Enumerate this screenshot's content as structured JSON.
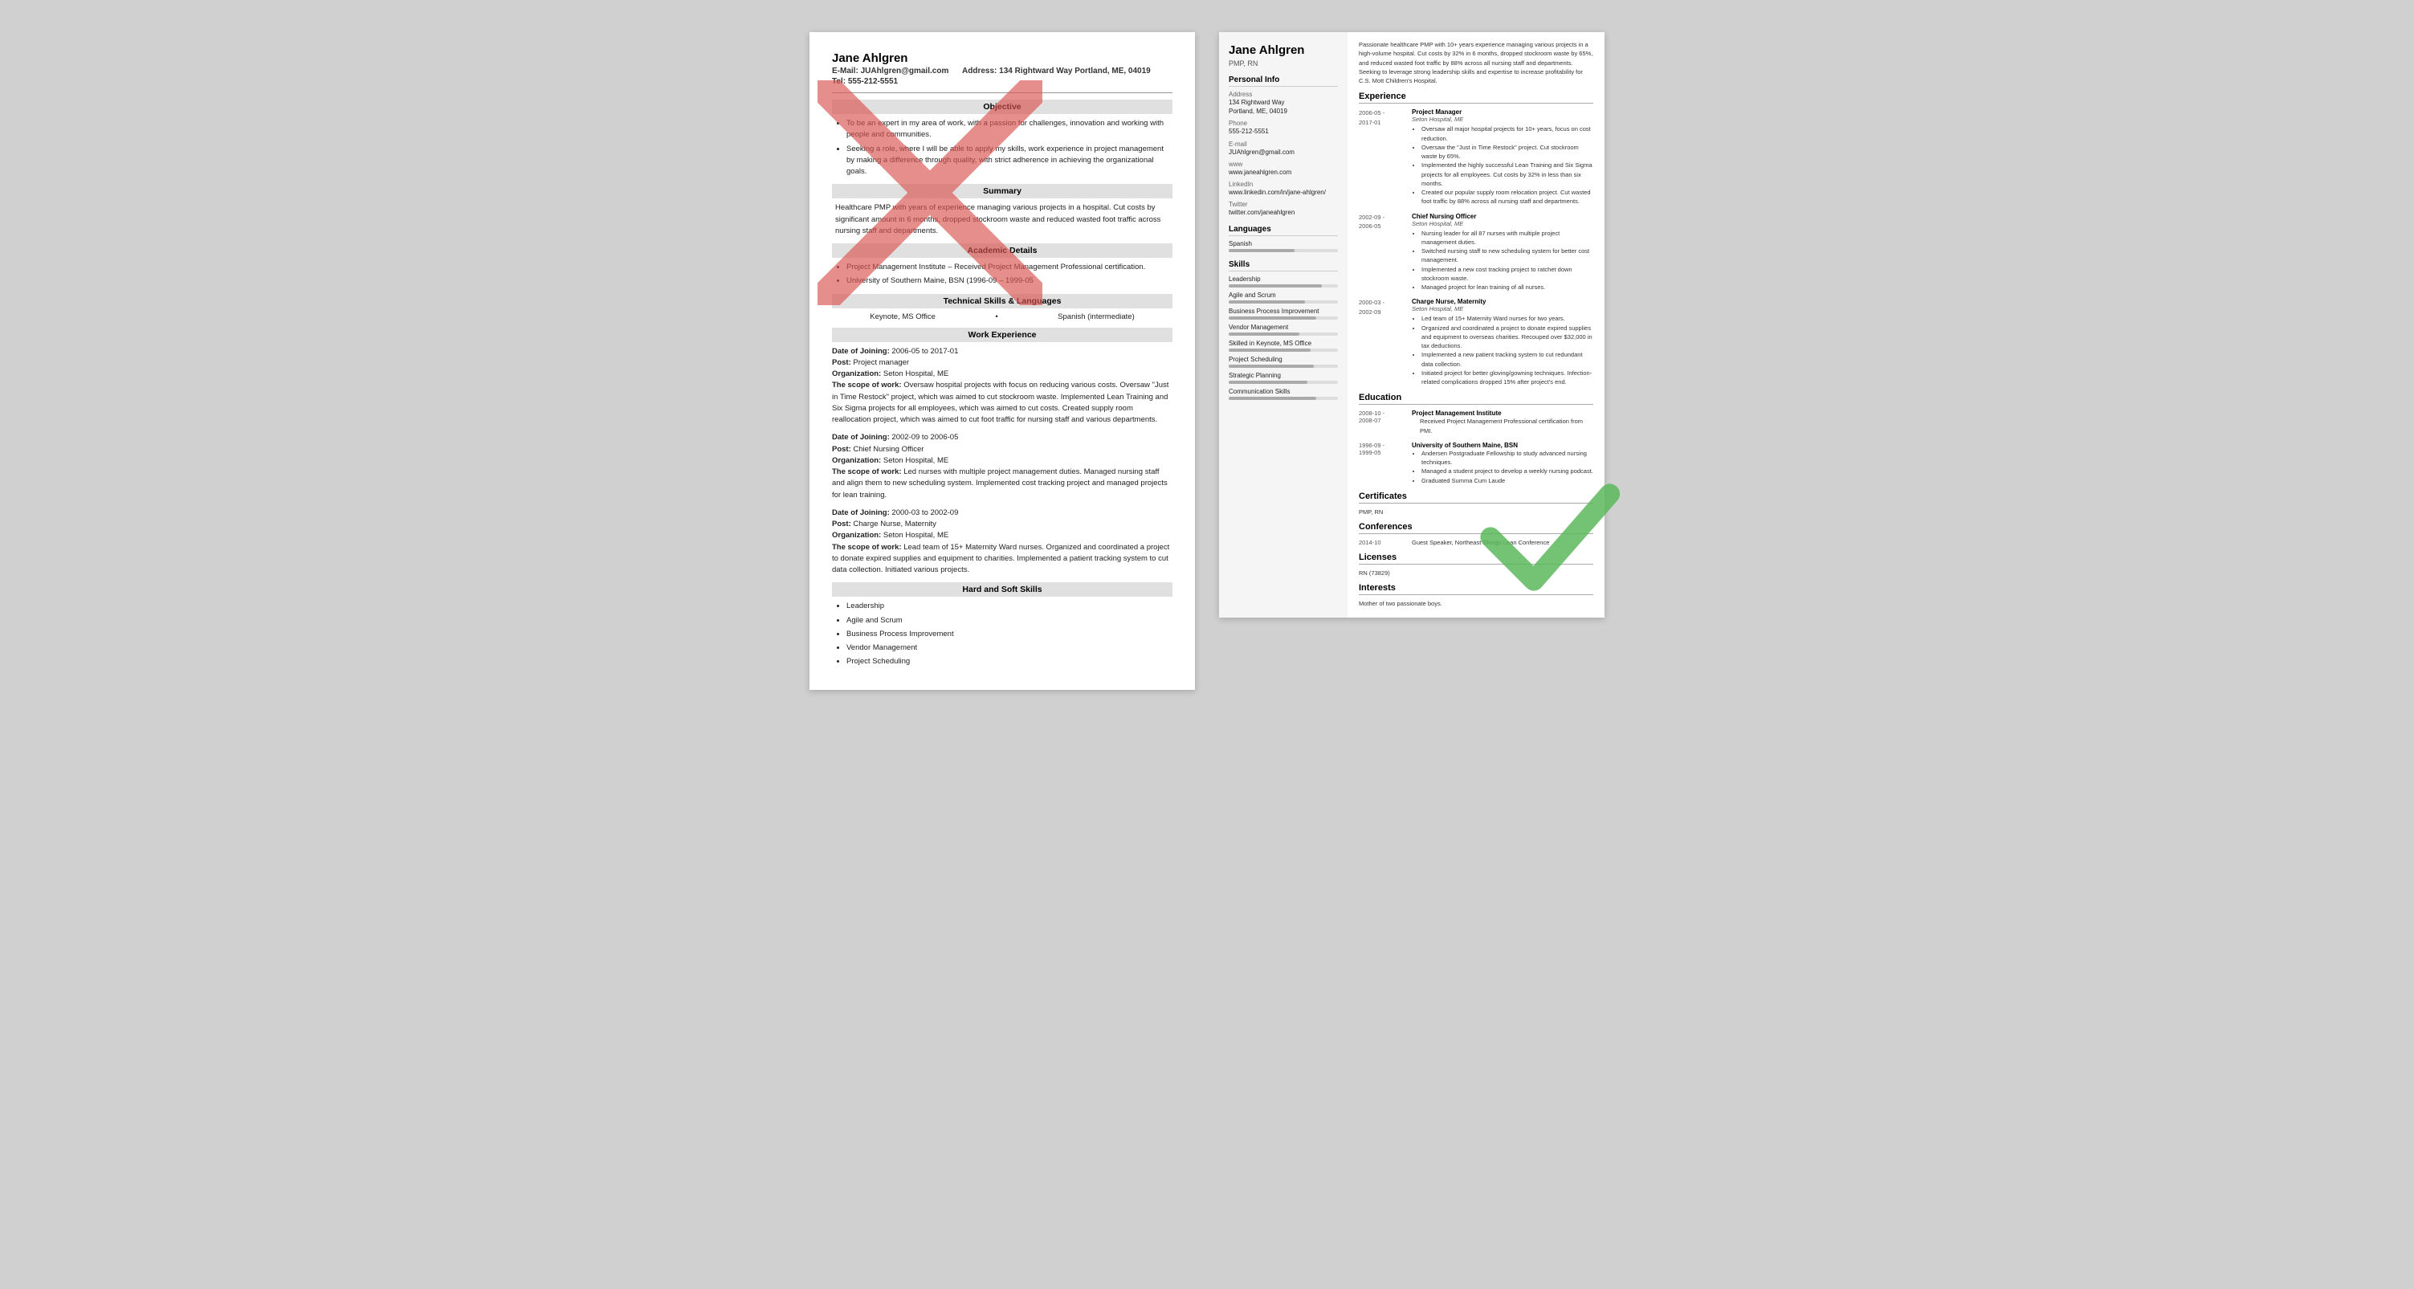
{
  "left": {
    "name": "Jane Ahlgren",
    "email_label": "E-Mail:",
    "email": "JUAhlgren@gmail.com",
    "address_label": "Address:",
    "address": "134 Rightward Way Portland, ME, 04019",
    "tel_label": "Tel:",
    "tel": "555-212-5551",
    "objective_header": "Objective",
    "objective_bullets": [
      "To be an expert in my area of work, with a passion for challenges, innovation and working with people and communities.",
      "Seeking a role, where I will be able to apply my skills, work experience in project management by making a difference through quality, with strict adherence in achieving the organizational goals."
    ],
    "summary_header": "Summary",
    "summary_text": "Healthcare PMP with years of experience managing various projects in a hospital. Cut costs by significant amount in 6 months, dropped stockroom waste and reduced wasted foot traffic across nursing staff and departments.",
    "academic_header": "Academic Details",
    "academic_bullets": [
      "Project Management Institute – Received Project Management Professional certification.",
      "University of Southern Maine, BSN (1996-09 – 1999-05"
    ],
    "skills_header": "Technical Skills & Languages",
    "skills_left": "Keynote, MS Office",
    "skills_right": "Spanish (intermediate)",
    "work_header": "Work Experience",
    "work_entries": [
      {
        "date_label": "Date of Joining:",
        "date": "2006-05 to 2017-01",
        "post_label": "Post:",
        "post": "Project manager",
        "org_label": "Organization:",
        "org": "Seton Hospital, ME",
        "scope_label": "The scope of work:",
        "scope": "Oversaw hospital projects with focus on reducing various costs. Oversaw \"Just in Time Restock\" project, which was aimed to cut stockroom waste. Implemented Lean Training and Six Sigma projects for all employees, which was aimed to cut costs. Created supply room reallocation project, which was aimed to cut foot traffic for nursing staff and various departments."
      },
      {
        "date_label": "Date of Joining:",
        "date": "2002-09 to 2006-05",
        "post_label": "Post:",
        "post": "Chief Nursing Officer",
        "org_label": "Organization:",
        "org": "Seton Hospital, ME",
        "scope_label": "The scope of work:",
        "scope": "Led nurses with multiple project management duties. Managed nursing staff and align them to new scheduling system. Implemented cost tracking project and managed projects for lean training."
      },
      {
        "date_label": "Date of Joining:",
        "date": "2000-03 to 2002-09",
        "post_label": "Post:",
        "post": "Charge Nurse, Maternity",
        "org_label": "Organization:",
        "org": "Seton Hospital, ME",
        "scope_label": "The scope of work:",
        "scope": "Lead team of 15+ Maternity Ward nurses. Organized and coordinated a project to donate expired supplies and equipment to charities. Implemented a patient tracking system to cut data collection. Initiated various projects."
      }
    ],
    "hard_soft_header": "Hard and Soft Skills",
    "hard_soft_bullets": [
      "Leadership",
      "Agile and Scrum",
      "Business Process Improvement",
      "Vendor Management",
      "Project Scheduling"
    ]
  },
  "right": {
    "name": "Jane Ahlgren",
    "title": "PMP, RN",
    "summary": "Passionate healthcare PMP with 10+ years experience managing various projects in a high-volume hospital. Cut costs by 32% in 6 months, dropped stockroom waste by 65%, and reduced wasted foot traffic by 88% across all nursing staff and departments. Seeking to leverage strong leadership skills and expertise to increase profitability for C.S. Mott Children's Hospital.",
    "personal_info": {
      "section": "Personal Info",
      "address_label": "Address",
      "address": "134 Rightward Way\nPortland, ME, 04019",
      "phone_label": "Phone",
      "phone": "555-212-5551",
      "email_label": "E-mail",
      "email": "JUAhlgren@gmail.com",
      "www_label": "www",
      "www": "www.janeahlgren.com",
      "linkedin_label": "LinkedIn",
      "linkedin": "www.linkedin.com/in/jane-ahlgren/",
      "twitter_label": "Twitter",
      "twitter": "twitter.com/janeahlgren"
    },
    "languages": {
      "section": "Languages",
      "items": [
        {
          "name": "Spanish",
          "level": 60
        }
      ]
    },
    "skills": {
      "section": "Skills",
      "items": [
        {
          "name": "Leadership",
          "level": 85
        },
        {
          "name": "Agile and Scrum",
          "level": 70
        },
        {
          "name": "Business Process Improvement",
          "level": 80
        },
        {
          "name": "Vendor Management",
          "level": 65
        },
        {
          "name": "Skilled in Keynote, MS Office",
          "level": 75
        },
        {
          "name": "Project Scheduling",
          "level": 78
        },
        {
          "name": "Strategic Planning",
          "level": 72
        },
        {
          "name": "Communication Skills",
          "level": 80
        }
      ]
    },
    "experience": {
      "section": "Experience",
      "entries": [
        {
          "dates": "2006-05 -\n2017-01",
          "title": "Project Manager",
          "org": "Seton Hospital, ME",
          "bullets": [
            "Oversaw all major hospital projects for 10+ years, focus on cost reduction.",
            "Oversaw the \"Just in Time Restock\" project. Cut stockroom waste by 65%.",
            "Implemented the highly successful Lean Training and Six Sigma projects for all employees. Cut costs by 32% in less than six months.",
            "Created our popular supply room relocation project. Cut wasted foot traffic by 88% across all nursing staff and departments."
          ]
        },
        {
          "dates": "2002-09 -\n2006-05",
          "title": "Chief Nursing Officer",
          "org": "Seton Hospital, ME",
          "bullets": [
            "Nursing leader for all 87 nurses with multiple project management duties.",
            "Switched nursing staff to new scheduling system for better cost management.",
            "Implemented a new cost tracking project to ratchet down stockroom waste.",
            "Managed project for lean training of all nurses."
          ]
        },
        {
          "dates": "2000-03 -\n2002-09",
          "title": "Charge Nurse, Maternity",
          "org": "Seton Hospital, ME",
          "bullets": [
            "Led team of 15+ Maternity Ward nurses for two years.",
            "Organized and coordinated a project to donate expired supplies and equipment to overseas charities. Recouped over $32,000 in tax deductions.",
            "Implemented a new patient tracking system to cut redundant data collection.",
            "Initiated project for better gloving/gowning techniques. Infection-related complications dropped 15% after project's end."
          ]
        }
      ]
    },
    "education": {
      "section": "Education",
      "entries": [
        {
          "dates": "2008-10 -\n2008-07",
          "name": "Project Management Institute",
          "desc": "Received Project Management Professional certification from PMI."
        },
        {
          "dates": "1996-09 -\n1999-05",
          "name": "University of Southern Maine, BSN",
          "bullets": [
            "Andersen Postgraduate Fellowship to study advanced nursing techniques.",
            "Managed a student project to develop a weekly nursing podcast.",
            "Graduated Summa Cum Laude"
          ]
        }
      ]
    },
    "certificates": {
      "section": "Certificates",
      "items": [
        "PMP, RN"
      ]
    },
    "conferences": {
      "section": "Conferences",
      "entries": [
        {
          "date": "2014-10",
          "title": "Guest Speaker, Northeast Shingo Lean Conference"
        }
      ]
    },
    "licenses": {
      "section": "Licenses",
      "items": [
        "RN (73829)"
      ]
    },
    "interests": {
      "section": "Interests",
      "items": [
        "Mother of two passionate boys."
      ]
    }
  }
}
